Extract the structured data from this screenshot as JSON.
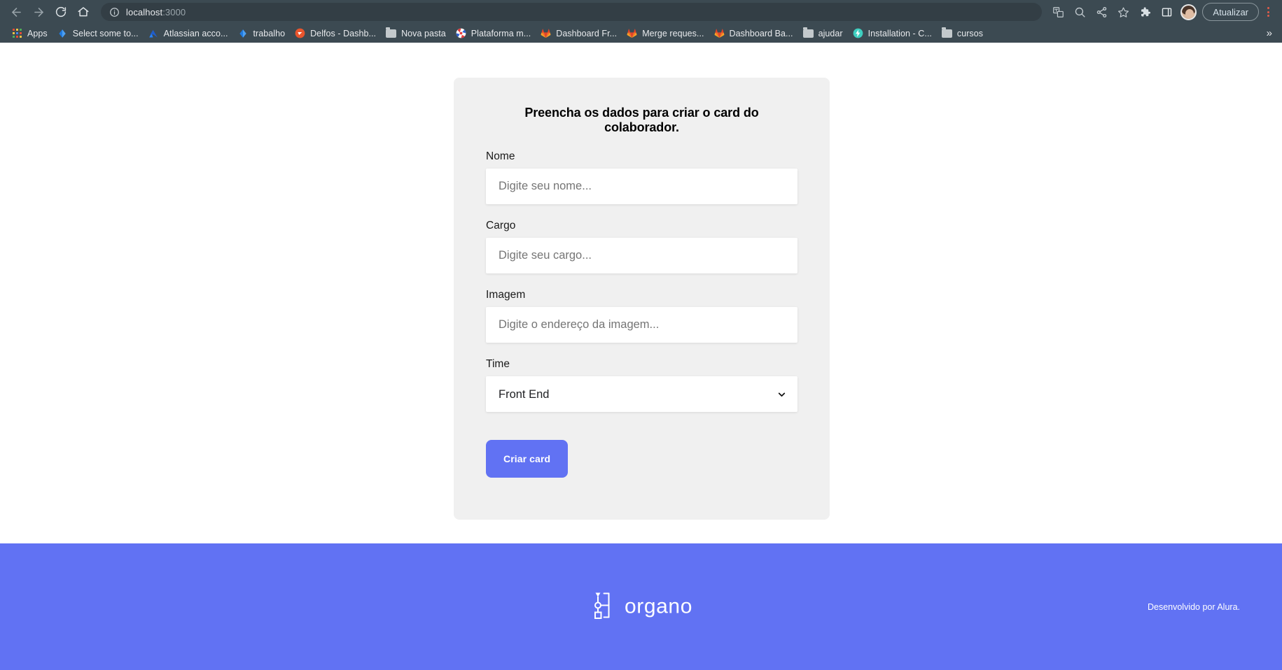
{
  "browser": {
    "nav": {
      "back_label": "Back",
      "forward_label": "Forward",
      "reload_label": "Reload",
      "home_label": "Home"
    },
    "omnibox": {
      "host": "localhost",
      "port": ":3000",
      "info_icon": "site-info-icon"
    },
    "actions": {
      "translate_label": "Translate",
      "zoom_label": "Zoom",
      "share_label": "Share",
      "bookmark_label": "Bookmark",
      "extensions_label": "Extensions",
      "sidebar_label": "Side panel",
      "profile_label": "Profile",
      "update_label": "Atualizar",
      "menu_label": "Customize and control"
    },
    "bookmarks": [
      {
        "label": "Apps",
        "icon": "apps-grid-icon"
      },
      {
        "label": "Select some to...",
        "icon": "diamond-blue-icon"
      },
      {
        "label": "Atlassian acco...",
        "icon": "atlassian-icon"
      },
      {
        "label": "trabalho",
        "icon": "diamond-blue-icon"
      },
      {
        "label": "Delfos - Dashb...",
        "icon": "delfos-icon"
      },
      {
        "label": "Nova pasta",
        "icon": "folder-icon"
      },
      {
        "label": "Plataforma m...",
        "icon": "plataforma-icon"
      },
      {
        "label": "Dashboard Fr...",
        "icon": "gitlab-icon"
      },
      {
        "label": "Merge reques...",
        "icon": "gitlab-icon"
      },
      {
        "label": "Dashboard Ba...",
        "icon": "gitlab-icon"
      },
      {
        "label": "ajudar",
        "icon": "folder-icon"
      },
      {
        "label": "Installation - C...",
        "icon": "lightning-teal-icon"
      },
      {
        "label": "cursos",
        "icon": "folder-icon"
      }
    ],
    "bookmarks_overflow": "»"
  },
  "form": {
    "title": "Preencha os dados para criar o card do colaborador.",
    "fields": [
      {
        "label": "Nome",
        "placeholder": "Digite seu nome...",
        "value": ""
      },
      {
        "label": "Cargo",
        "placeholder": "Digite seu cargo...",
        "value": ""
      },
      {
        "label": "Imagem",
        "placeholder": "Digite o endereço da imagem...",
        "value": ""
      }
    ],
    "team": {
      "label": "Time",
      "selected": "Front End",
      "options": [
        "Front End"
      ]
    },
    "submit_label": "Criar card"
  },
  "footer": {
    "logo_text": "organo",
    "logo_icon": "org-chart-icon",
    "credit": "Desenvolvido por Alura."
  },
  "colors": {
    "brand": "#6172f3",
    "chrome": "#3c4a52",
    "card": "#f0f0f0",
    "page": "#ffffff"
  }
}
